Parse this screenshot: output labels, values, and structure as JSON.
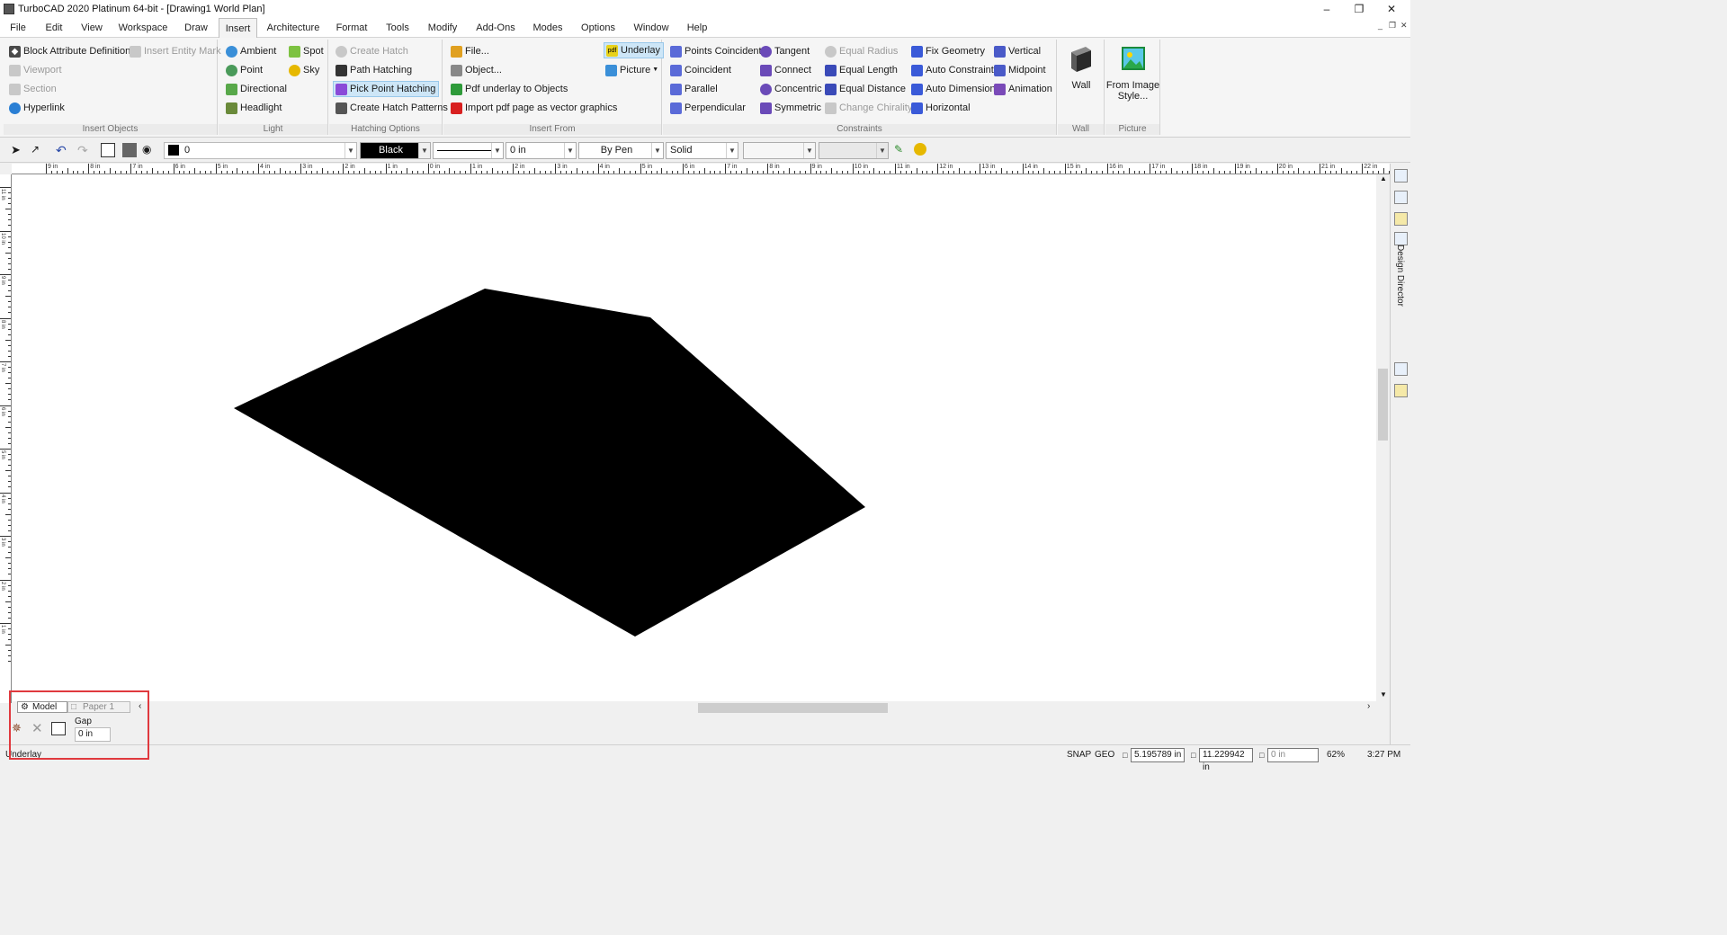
{
  "titlebar": {
    "title": "TurboCAD 2020 Platinum 64-bit - [Drawing1 World Plan]",
    "controls": [
      "minimize-icon",
      "restore-icon",
      "close-icon"
    ]
  },
  "menubar": {
    "items": [
      "File",
      "Edit",
      "View",
      "Workspace",
      "Draw",
      "Insert",
      "Architecture",
      "Format",
      "Tools",
      "Modify",
      "Add-Ons",
      "Modes",
      "Options",
      "Window",
      "Help"
    ],
    "active": "Insert"
  },
  "ribbon": {
    "insert_objects": {
      "caption": "Insert Objects",
      "items": [
        "Block Attribute Definition",
        "Insert Entity Mark",
        "Viewport",
        "Section",
        "Hyperlink"
      ]
    },
    "light": {
      "caption": "Light",
      "items": [
        "Ambient",
        "Spot",
        "Point",
        "Sky",
        "Directional",
        "Headlight"
      ]
    },
    "hatching": {
      "caption": "Hatching Options",
      "items": [
        "Create Hatch",
        "Path Hatching",
        "Pick Point Hatching",
        "Create Hatch Patterns"
      ]
    },
    "insert_from": {
      "caption": "Insert From",
      "items": [
        "File...",
        "Object...",
        "Pdf underlay to Objects",
        "Import pdf page as vector graphics",
        "Underlay",
        "Picture"
      ]
    },
    "constraints": {
      "caption": "Constraints",
      "items": [
        "Points Coincident",
        "Tangent",
        "Equal Radius",
        "Fix Geometry",
        "Vertical",
        "Coincident",
        "Connect",
        "Equal Length",
        "Auto Constraint",
        "Midpoint",
        "Parallel",
        "Concentric",
        "Equal Distance",
        "Auto Dimension",
        "Animation",
        "Perpendicular",
        "Symmetric",
        "Change Chirality",
        "Horizontal"
      ]
    },
    "wall": {
      "caption": "Wall",
      "label": "Wall"
    },
    "picture": {
      "caption": "Picture",
      "label_line1": "From Image",
      "label_line2": "Style..."
    }
  },
  "propbar": {
    "layer": "0",
    "color": "Black",
    "width": "0 in",
    "pen": "By Pen",
    "style": "Solid"
  },
  "ruler": {
    "h_labels": [
      "9 in",
      "8 in",
      "7 in",
      "6 in",
      "5 in",
      "4 in",
      "3 in",
      "2 in",
      "1 in",
      "0 in",
      "1 in",
      "2 in",
      "3 in",
      "4 in",
      "5 in",
      "6 in",
      "7 in",
      "8 in",
      "9 in",
      "10 in",
      "11 in",
      "12 in",
      "13 in",
      "14 in",
      "15 in",
      "16 in",
      "17 in",
      "18 in",
      "19 in",
      "20 in",
      "21 in",
      "22 in"
    ],
    "v_labels": [
      "11 in",
      "10 in",
      "9 in",
      "8 in",
      "7 in",
      "6 in",
      "5 in",
      "4 in",
      "3 in",
      "2 in",
      "1 in"
    ]
  },
  "side": {
    "design_director": "Design Director"
  },
  "tabs": {
    "model": "Model",
    "paper": "Paper 1"
  },
  "localtb": {
    "gap_label": "Gap",
    "gap_value": "0 in"
  },
  "status": {
    "prompt": "Underlay",
    "snap": "SNAP",
    "geo": "GEO",
    "x": "5.195789 in",
    "y": "11.229942 in",
    "z": "0 in",
    "zoom": "62%",
    "time": "3:27 PM"
  }
}
